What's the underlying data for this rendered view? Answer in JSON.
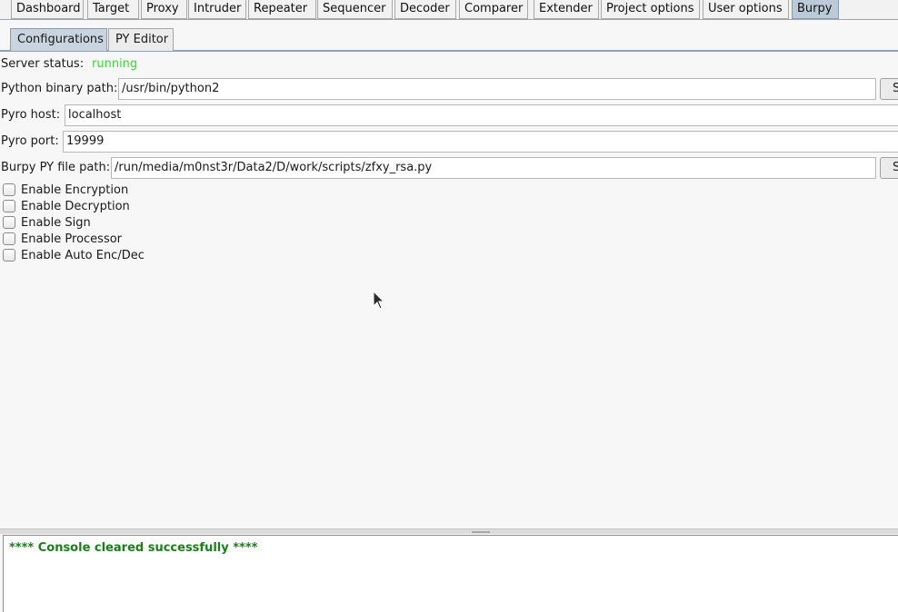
{
  "top_tabs": [
    "Dashboard",
    "Target",
    "Proxy",
    "Intruder",
    "Repeater",
    "Sequencer",
    "Decoder",
    "Comparer",
    "Extender",
    "Project options",
    "User options",
    "Burpy"
  ],
  "sub_tabs": [
    "Configurations",
    "PY Editor"
  ],
  "config": {
    "server_status_label": "Server status:",
    "server_status_value": "running",
    "python_path_label": "Python binary path:",
    "python_path_value": "/usr/bin/python2",
    "python_path_button": "S",
    "pyro_host_label": "Pyro host:",
    "pyro_host_value": "localhost",
    "pyro_port_label": "Pyro port:",
    "pyro_port_value": "19999",
    "burpy_file_label": "Burpy PY file path:",
    "burpy_file_value": "/run/media/m0nst3r/Data2/D/work/scripts/zfxy_rsa.py",
    "burpy_file_button": "S"
  },
  "options": [
    "Enable Encryption",
    "Enable Decryption",
    "Enable Sign",
    "Enable Processor",
    "Enable Auto Enc/Dec"
  ],
  "console": {
    "text": "**** Console cleared successfully ****"
  },
  "colors": {
    "status_running": "#3fd23f",
    "console_text": "#1b7d1b",
    "active_tab": "#bccad8"
  }
}
